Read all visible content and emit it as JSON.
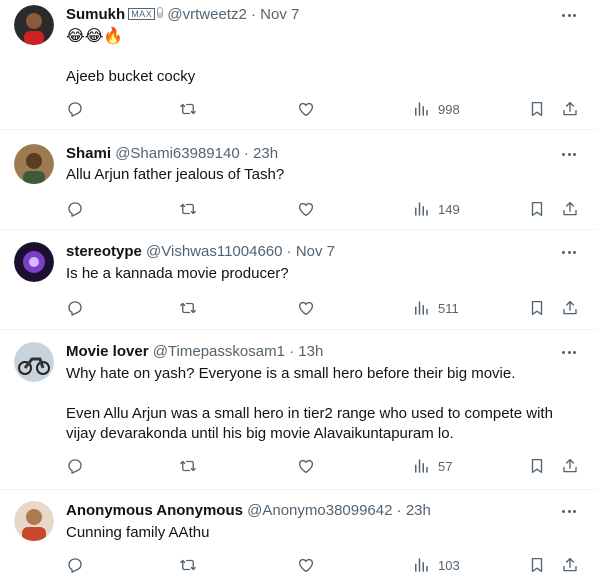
{
  "replies": [
    {
      "name": "Sumukh",
      "badge": "MAX",
      "handle": "@vrtweetz2",
      "separator": "·",
      "time": "Nov 7",
      "emoji": "😂😂🔥",
      "paragraphs": [
        "Ajeeb bucket cocky"
      ],
      "views": "998",
      "avatar_color": "#3a3a3a"
    },
    {
      "name": "Shami",
      "handle": "@Shami63989140",
      "separator": "·",
      "time": "23h",
      "paragraphs": [
        "Allu Arjun father jealous of Tash?"
      ],
      "views": "149",
      "avatar_color": "#7a5c3e"
    },
    {
      "name": "stereotype",
      "handle": "@Vishwas11004660",
      "separator": "·",
      "time": "Nov 7",
      "paragraphs": [
        "Is he a kannada movie producer?"
      ],
      "views": "511",
      "avatar_color": "#5b2a86"
    },
    {
      "name": "Movie lover",
      "handle": "@Timepasskosam1",
      "separator": "·",
      "time": "13h",
      "paragraphs": [
        "Why hate on yash? Everyone is a small hero before their big movie.",
        "Even Allu Arjun was a small hero in tier2 range who used to compete with vijay devarakonda until his big movie Alavaikuntapuram lo."
      ],
      "views": "57",
      "avatar_color": "#6f7c88"
    },
    {
      "name": "Anonymous Anonymous",
      "handle": "@Anonymo38099642",
      "separator": "·",
      "time": "23h",
      "paragraphs": [
        "Cunning family AAthu"
      ],
      "views": "103",
      "avatar_color": "#b07850"
    }
  ],
  "icons": {
    "reply": "reply-icon",
    "retweet": "retweet-icon",
    "like": "like-icon",
    "views": "views-icon",
    "bookmark": "bookmark-icon",
    "share": "share-icon",
    "more": "more-icon"
  },
  "colors": {
    "text": "#0f1419",
    "muted": "#536471",
    "divider": "#eff3f4"
  }
}
